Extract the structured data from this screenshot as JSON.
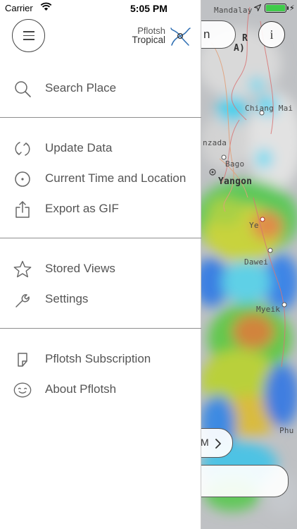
{
  "status_bar": {
    "carrier": "Carrier",
    "time": "5:05 PM"
  },
  "brand": {
    "line1": "Pflotsh",
    "line2": "Tropical"
  },
  "menu_sections": [
    {
      "items": [
        {
          "label": "Search Place",
          "icon": "search-icon"
        }
      ]
    },
    {
      "items": [
        {
          "label": "Update Data",
          "icon": "refresh-icon"
        },
        {
          "label": "Current Time and Location",
          "icon": "target-icon"
        },
        {
          "label": "Export as GIF",
          "icon": "share-icon"
        }
      ]
    },
    {
      "items": [
        {
          "label": "Stored Views",
          "icon": "star-icon"
        },
        {
          "label": "Settings",
          "icon": "wrench-icon"
        }
      ]
    },
    {
      "items": [
        {
          "label": "Pflotsh Subscription",
          "icon": "sticker-icon"
        },
        {
          "label": "About Pflotsh",
          "icon": "smiley-icon"
        }
      ]
    }
  ],
  "map": {
    "labels": {
      "mandalay": "Mandalay",
      "chiang_mai": "Chiang Mai",
      "nzada": "nzada",
      "bago": "Bago",
      "yangon": "Yangon",
      "ye": "Ye",
      "dawei": "Dawei",
      "myeik": "Myeik",
      "phu": "Phu",
      "partial_r": "R",
      "partial_a": "A)"
    },
    "top_pill_text": "n",
    "info_button": "i",
    "bottom_pill_text": "M"
  },
  "colors": {
    "drawer_text": "#555555",
    "separator": "#8e8e8e",
    "battery": "#3fcb4a"
  }
}
